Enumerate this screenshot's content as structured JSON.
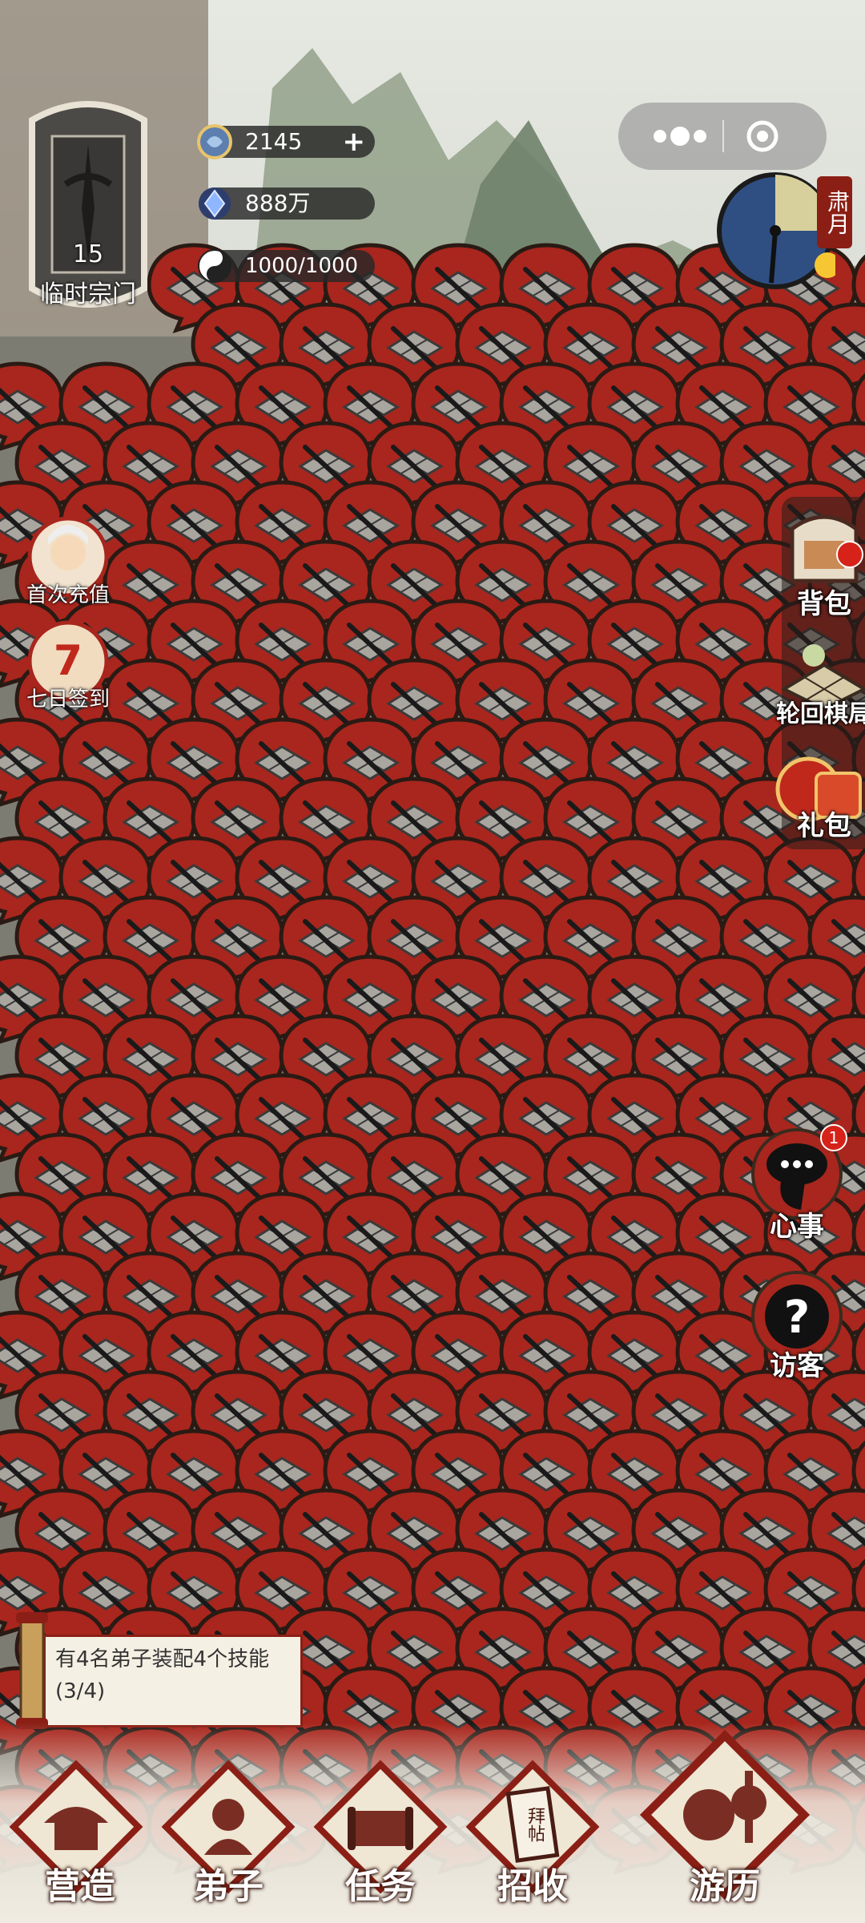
{
  "resources": {
    "spirit_stone": {
      "value": "2145",
      "icon": "spirit-stone-icon",
      "add_label": "+"
    },
    "crystal": {
      "value": "888万",
      "icon": "crystal-icon"
    },
    "yinyang": {
      "value": "1000/1000",
      "icon": "yin-yang-icon"
    }
  },
  "sect": {
    "level": "15",
    "name": "临时宗门",
    "icon": "sword-banner-icon"
  },
  "season": "肃月",
  "left_menu": [
    {
      "label": "首次充值",
      "icon": "first-recharge-icon"
    },
    {
      "label": "七日签到",
      "icon": "seven-day-signin-icon"
    }
  ],
  "right_menu": [
    {
      "label": "背包",
      "icon": "backpack-icon"
    },
    {
      "label": "轮回棋局",
      "icon": "chess-board-icon"
    },
    {
      "label": "礼包",
      "icon": "gift-pack-icon"
    }
  ],
  "thoughts": {
    "label": "心事",
    "badge": "1",
    "icon": "thought-bubble-icon"
  },
  "visitors": {
    "label": "访客",
    "icon": "question-mark-icon"
  },
  "quest": {
    "text": "有4名弟子装配4个技能(3/4)"
  },
  "bottom_nav": [
    {
      "label": "营造",
      "icon": "pavilion-icon"
    },
    {
      "label": "弟子",
      "icon": "disciple-icon"
    },
    {
      "label": "任务",
      "icon": "scroll-icon"
    },
    {
      "label": "招收",
      "icon": "invitation-card-icon",
      "card_text": "拜帖"
    },
    {
      "label": "游历",
      "icon": "gourd-travel-icon"
    }
  ],
  "colors": {
    "bubble_red": "#a8261d",
    "frame_red": "#8b1f15",
    "badge_red": "#d62218"
  }
}
